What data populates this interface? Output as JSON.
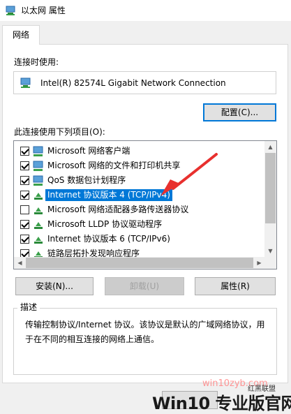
{
  "window": {
    "title": "以太网 属性"
  },
  "tabs": [
    {
      "label": "网络"
    }
  ],
  "connect_using": {
    "label": "连接时使用:",
    "adapter": "Intel(R) 82574L Gigabit Network Connection",
    "configure_button": "配置(C)..."
  },
  "items_section": {
    "label": "此连接使用下列项目(O):",
    "items": [
      {
        "label": "Microsoft 网络客户端",
        "checked": true,
        "icon": "network-client-icon"
      },
      {
        "label": "Microsoft 网络的文件和打印机共享",
        "checked": true,
        "icon": "network-share-icon"
      },
      {
        "label": "QoS 数据包计划程序",
        "checked": true,
        "icon": "network-service-icon"
      },
      {
        "label": "Internet 协议版本 4 (TCP/IPv4)",
        "checked": true,
        "selected": true,
        "icon": "protocol-icon"
      },
      {
        "label": "Microsoft 网络适配器多路传送器协议",
        "checked": false,
        "icon": "protocol-icon"
      },
      {
        "label": "Microsoft LLDP 协议驱动程序",
        "checked": true,
        "icon": "protocol-icon"
      },
      {
        "label": "Internet 协议版本 6 (TCP/IPv6)",
        "checked": true,
        "icon": "protocol-icon"
      },
      {
        "label": "链路层拓扑发现响应程序",
        "checked": true,
        "icon": "protocol-icon"
      }
    ]
  },
  "buttons": {
    "install": "安装(N)...",
    "uninstall": "卸载(U)",
    "properties": "属性(R)"
  },
  "description": {
    "title": "描述",
    "text": "传输控制协议/Internet 协议。该协议是默认的广域网络协议，用于在不同的相互连接的网络上通信。"
  },
  "watermarks": {
    "site": "win10zyb.com",
    "brand": "Win10 专业版官网",
    "corner_text": "红黑联盟"
  },
  "colors": {
    "selection": "#0078d7",
    "arrow": "#e8302e"
  }
}
